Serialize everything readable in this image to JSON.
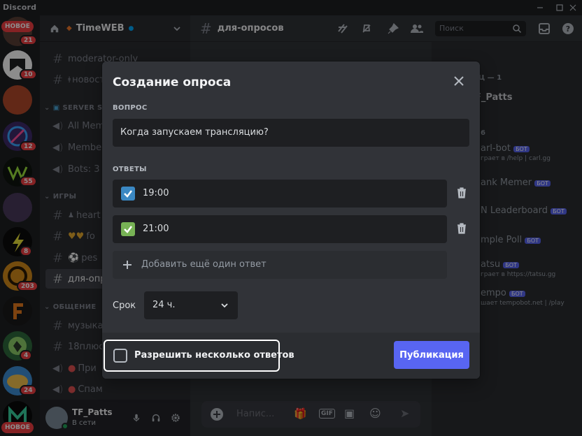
{
  "window": {
    "app_name": "Discord"
  },
  "rail": {
    "top_pill": "НОВОЕ",
    "bottom_pill": "НОВОЕ",
    "badges": [
      "21",
      "10",
      "12",
      "55",
      "8",
      "203",
      "4",
      "24"
    ]
  },
  "guild": {
    "name": "TimeWEB"
  },
  "sidebar": {
    "channels": [
      {
        "name": "moderator-only"
      },
      {
        "name": "новост"
      },
      {
        "name": "All Mem"
      },
      {
        "name": "Member"
      },
      {
        "name": "Bots: 3"
      },
      {
        "name": "heart"
      },
      {
        "name": "fo"
      },
      {
        "name": "pes"
      },
      {
        "name": "для-опро"
      },
      {
        "name": "музыка"
      },
      {
        "name": "18плюс"
      },
      {
        "name": "При"
      },
      {
        "name": "Спам"
      }
    ],
    "categories": {
      "server_stats": "SERVER ST",
      "games": "ИГРЫ",
      "general": "ОБЩЕНИЕ"
    }
  },
  "user": {
    "name": "TF_Patts",
    "status": "В сети"
  },
  "channel_header": {
    "name": "для-опросов",
    "search_placeholder": "Поиск"
  },
  "members": {
    "owner_section": "ЕЦ — 1",
    "owner_name": "F_Patts",
    "bots_section": "6",
    "rows": [
      {
        "name": "arl-bot",
        "tag": "БОТ",
        "activity": "грает в /help | carl.gg"
      },
      {
        "name": "ank Memer",
        "tag": "БОТ",
        "activity": ""
      },
      {
        "name": "N Leaderboard",
        "tag": "БОТ",
        "activity": ""
      },
      {
        "name": "mple Poll",
        "tag": "БОТ",
        "activity": ""
      },
      {
        "name": "atsu",
        "tag": "БОТ",
        "activity": "грает в https://tatsu.gg"
      },
      {
        "name": "empo",
        "tag": "БОТ",
        "activity": "шает tempobot.net | /play"
      }
    ]
  },
  "composer": {
    "placeholder": "Напис..."
  },
  "modal": {
    "title": "Создание опроса",
    "question_label": "ВОПРОС",
    "question_value": "Когда запускаем трансляцию?",
    "answers_label": "ОТВЕТЫ",
    "answers": [
      {
        "text": "19:00",
        "emoji": "checkbox-blue-icon",
        "color": "#3b88c3"
      },
      {
        "text": "21:00",
        "emoji": "checkbox-green-icon",
        "color": "#77b255"
      }
    ],
    "add_answer": "Добавить ещё один ответ",
    "duration_label": "Срок",
    "duration_value": "24 ч.",
    "multi_answer_label": "Разрешить несколько ответов",
    "multi_answer_checked": false,
    "publish_label": "Публикация"
  },
  "colors": {
    "accent": "#5865f2",
    "danger": "#f23f43",
    "bg_dark": "#1e1f22",
    "bg_sidebar": "#2b2d31",
    "bg_main": "#313338"
  }
}
